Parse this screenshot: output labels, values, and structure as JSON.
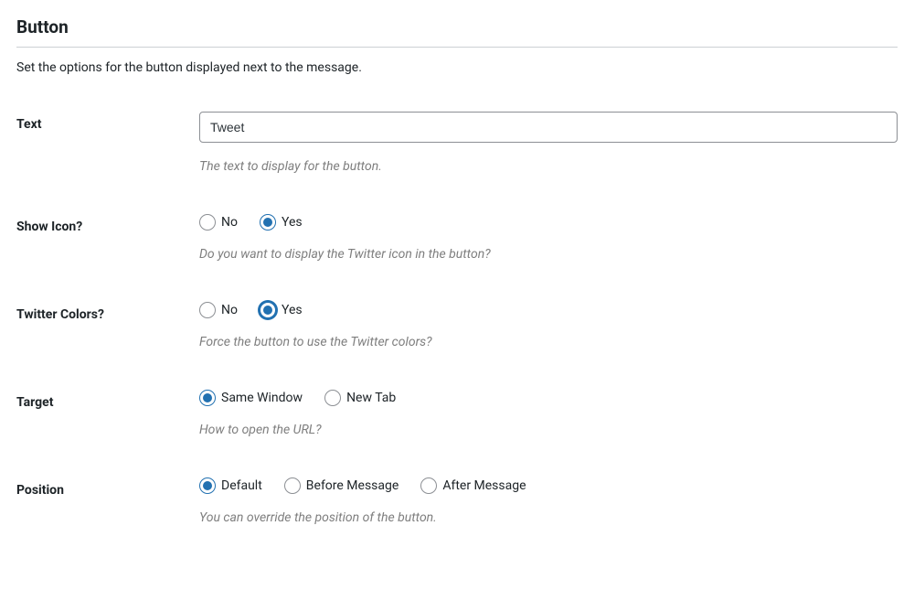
{
  "section": {
    "title": "Button",
    "description": "Set the options for the button displayed next to the message."
  },
  "fields": {
    "text": {
      "label": "Text",
      "value": "Tweet",
      "help": "The text to display for the button."
    },
    "showIcon": {
      "label": "Show Icon?",
      "options": {
        "no": "No",
        "yes": "Yes"
      },
      "help": "Do you want to display the Twitter icon in the button?"
    },
    "twitterColors": {
      "label": "Twitter Colors?",
      "options": {
        "no": "No",
        "yes": "Yes"
      },
      "help": "Force the button to use the Twitter colors?"
    },
    "target": {
      "label": "Target",
      "options": {
        "sameWindow": "Same Window",
        "newTab": "New Tab"
      },
      "help": "How to open the URL?"
    },
    "position": {
      "label": "Position",
      "options": {
        "default": "Default",
        "before": "Before Message",
        "after": "After Message"
      },
      "help": "You can override the position of the button."
    }
  }
}
